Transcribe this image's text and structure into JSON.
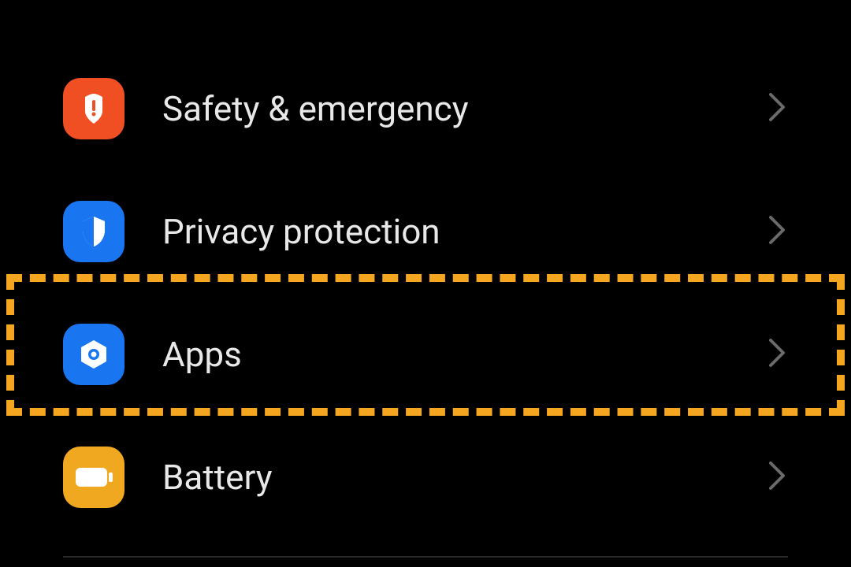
{
  "settings": {
    "items": [
      {
        "id": "safety",
        "label": "Safety & emergency"
      },
      {
        "id": "privacy",
        "label": "Privacy protection"
      },
      {
        "id": "apps",
        "label": "Apps"
      },
      {
        "id": "battery",
        "label": "Battery"
      }
    ]
  },
  "highlight": {
    "item": "apps",
    "color": "#f5a621"
  }
}
